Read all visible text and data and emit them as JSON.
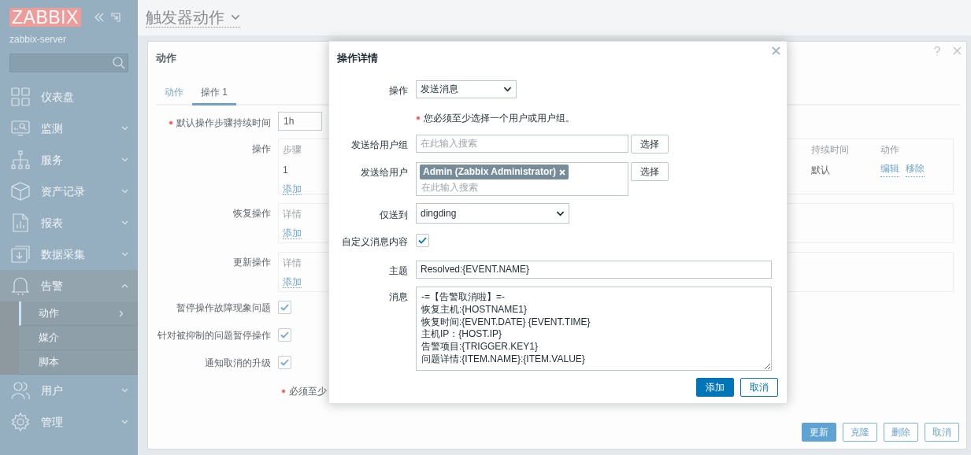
{
  "header": {
    "logo": "ZABBIX",
    "server": "zabbix-server",
    "title": "触发器动作"
  },
  "sidebar": {
    "items": [
      {
        "label": "仪表盘"
      },
      {
        "label": "监测",
        "expanded": false
      },
      {
        "label": "服务",
        "expanded": false
      },
      {
        "label": "资产记录",
        "expanded": false
      },
      {
        "label": "报表",
        "expanded": false
      },
      {
        "label": "数据采集",
        "expanded": false
      },
      {
        "label": "告警",
        "expanded": true,
        "children": [
          {
            "label": "动作",
            "selected": true
          },
          {
            "label": "媒介",
            "selected": false
          },
          {
            "label": "脚本",
            "selected": false
          }
        ]
      },
      {
        "label": "用户",
        "expanded": false
      },
      {
        "label": "管理",
        "expanded": false
      }
    ]
  },
  "card": {
    "title": "动作",
    "tabs": [
      {
        "label": "动作",
        "selected": false
      },
      {
        "label": "操作 1",
        "selected": true
      }
    ],
    "duration": {
      "label": "默认操作步骤持续时间",
      "required": true,
      "value": "1h"
    },
    "operations": {
      "label": "操作",
      "columns": [
        "步骤",
        "持续时间",
        "动作"
      ],
      "rows": [
        {
          "step": "1",
          "duration": "默认",
          "actions": [
            "编辑",
            "移除"
          ]
        }
      ],
      "add": "添加"
    },
    "recovery": {
      "label": "恢复操作",
      "column": "详情",
      "add": "添加"
    },
    "update": {
      "label": "更新操作",
      "column": "详情",
      "add": "添加"
    },
    "checks": [
      {
        "label": "暂停操作故障现象问题",
        "checked": true
      },
      {
        "label": "针对被抑制的问题暂停操作",
        "checked": true
      },
      {
        "label": "通知取消的升级",
        "checked": true
      }
    ],
    "required_note": "必须至少",
    "buttons": [
      {
        "label": "更新",
        "primary": true
      },
      {
        "label": "克隆",
        "primary": false
      },
      {
        "label": "删除",
        "primary": false
      },
      {
        "label": "取消",
        "primary": false
      }
    ]
  },
  "modal": {
    "title": "操作详情",
    "operation": {
      "label": "操作",
      "value": "发送消息"
    },
    "note": "您必须至少选择一个用户或用户组。",
    "user_groups": {
      "label": "发送给用户组",
      "placeholder": "在此输入搜索",
      "button": "选择"
    },
    "users": {
      "label": "发送给用户",
      "tags": [
        "Admin (Zabbix Administrator)"
      ],
      "placeholder": "在此输入搜索",
      "button": "选择"
    },
    "send_only_to": {
      "label": "仅送到",
      "value": "dingding"
    },
    "custom_message": {
      "label": "自定义消息内容",
      "checked": true
    },
    "subject": {
      "label": "主题",
      "value": "Resolved:{EVENT.NAME}"
    },
    "message": {
      "label": "消息",
      "value": "-=【告警取消啦】=-\n恢复主机:{HOSTNAME1}\n恢复时间:{EVENT.DATE} {EVENT.TIME}\n主机IP：{HOST.IP}\n告警项目:{TRIGGER.KEY1}\n问题详情:{ITEM.NAME}:{ITEM.VALUE}"
    },
    "buttons": [
      {
        "label": "添加",
        "primary": true
      },
      {
        "label": "取消",
        "primary": false
      }
    ]
  }
}
